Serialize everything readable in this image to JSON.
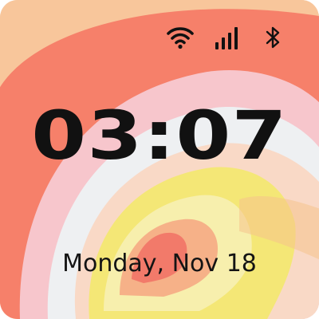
{
  "lock_screen": {
    "time": "03:07",
    "date": "Monday, Nov 18"
  },
  "status_bar": {
    "icons": [
      "wifi-icon",
      "cellular-signal-icon",
      "bluetooth-icon"
    ]
  },
  "colors": {
    "text": "#111111",
    "wallpaper_outer": "#f8c69b",
    "wallpaper_red": "#f6806a",
    "wallpaper_pink": "#f7c6cc",
    "wallpaper_light": "#eef0f2",
    "wallpaper_yellow": "#f4e776"
  }
}
